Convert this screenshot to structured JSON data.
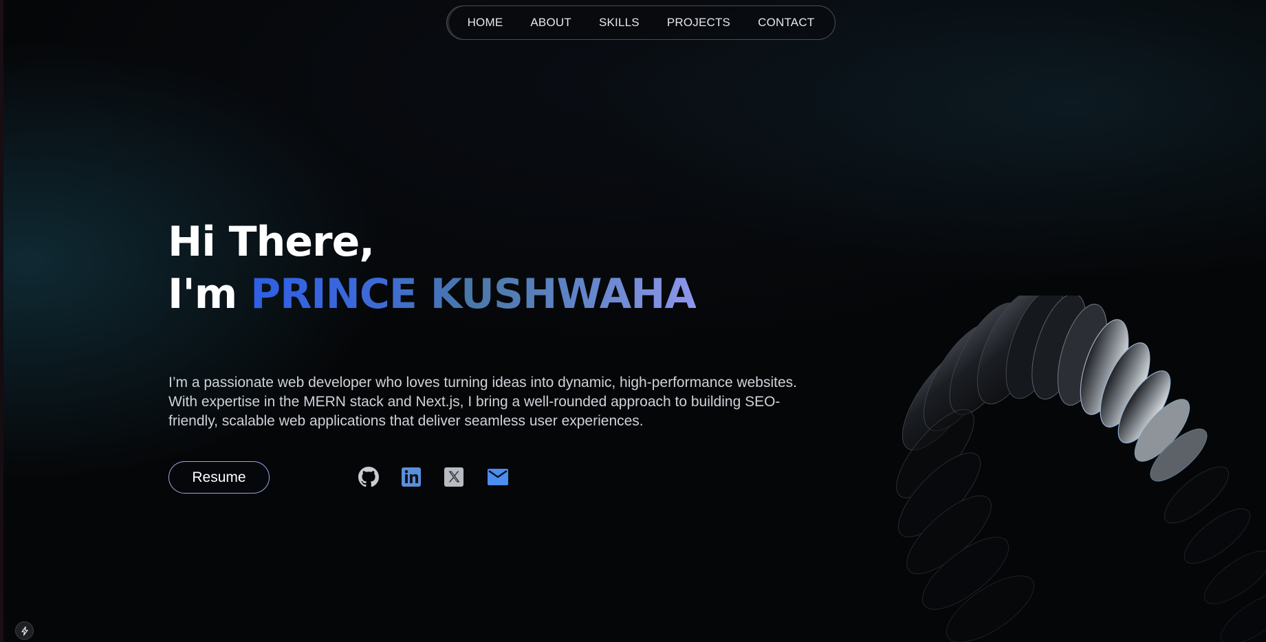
{
  "nav": {
    "items": [
      {
        "label": "HOME"
      },
      {
        "label": "ABOUT"
      },
      {
        "label": "SKILLS"
      },
      {
        "label": "PROJECTS"
      },
      {
        "label": "CONTACT"
      }
    ]
  },
  "hero": {
    "greeting": "Hi There,",
    "prefix": "I'm",
    "name": "PRINCE KUSHWAHA",
    "intro": "I’m a passionate web developer who loves turning ideas into dynamic, high-performance websites. With expertise in the MERN stack and Next.js, I bring a well-rounded approach to building SEO-friendly, scalable web applications that deliver seamless user experiences."
  },
  "actions": {
    "resume_label": "Resume"
  },
  "social": [
    {
      "icon": "github-icon"
    },
    {
      "icon": "linkedin-icon"
    },
    {
      "icon": "x-twitter-icon"
    },
    {
      "icon": "mail-icon"
    }
  ],
  "colors": {
    "background": "#050608",
    "name_gradient_start": "#2f5fe4",
    "name_gradient_end": "#8d96ec",
    "button_border": "#9aa6e6",
    "linkedin": "#5b8fd9",
    "mail": "#4c8df0"
  },
  "decor": {
    "badge_icon": "bolt-icon"
  }
}
